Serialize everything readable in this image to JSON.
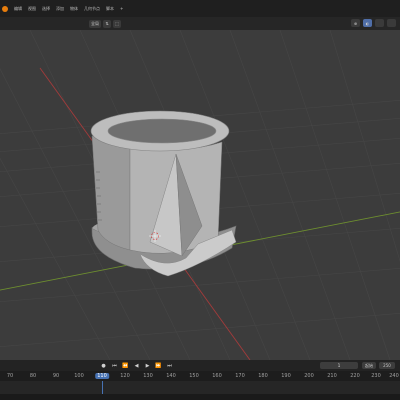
{
  "menu": {
    "items": [
      "编辑",
      "视图",
      "选择",
      "添加",
      "物体",
      "几何节点",
      "脚本",
      "+"
    ]
  },
  "viewport_header": {
    "transform_orientation": "全局",
    "buttons": [
      "⇅",
      "⬚",
      "⊕",
      "◐"
    ]
  },
  "timeline": {
    "current_frame": "1",
    "start_label": "起始",
    "start_value": "1",
    "end_value": "250",
    "controls": [
      "●",
      "⏮",
      "⏪",
      "◀",
      "▶",
      "⏩",
      "⏭"
    ],
    "ruler_ticks": [
      "70",
      "80",
      "90",
      "100",
      "110",
      "120",
      "130",
      "140",
      "150",
      "160",
      "170",
      "180",
      "190",
      "200",
      "210",
      "220",
      "230",
      "240"
    ]
  },
  "colors": {
    "accent": "#4772b3",
    "viewport_bg": "#3c3c3c",
    "model_gray": "#a6a6a6",
    "axis_x_red": "#a33b3b",
    "axis_y_green": "#6e8f2f"
  }
}
